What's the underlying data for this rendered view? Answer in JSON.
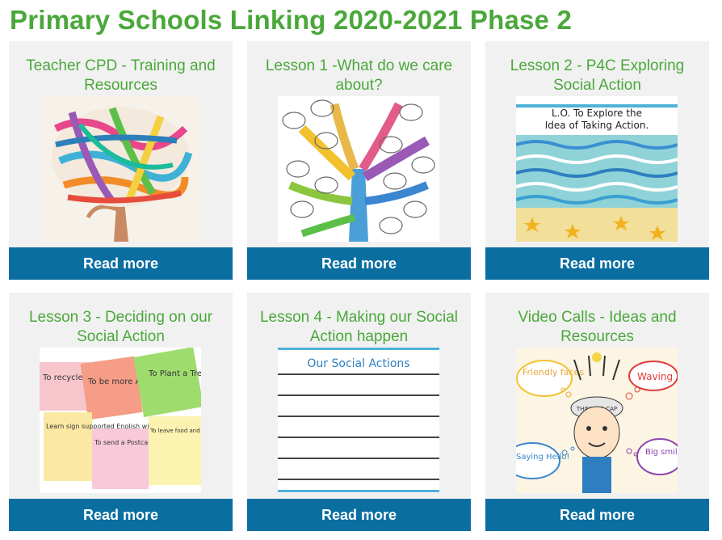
{
  "page": {
    "title": "Primary Schools Linking 2020-2021 Phase 2"
  },
  "cards": [
    {
      "title": "Teacher CPD - Training and Resources",
      "button": "Read more",
      "image": "colourful-ribbon-tree"
    },
    {
      "title": "Lesson 1 -What do we care about?",
      "button": "Read more",
      "image": "rainbow-tree-with-speech-bubbles"
    },
    {
      "title": "Lesson 2 - P4C Exploring Social Action",
      "button": "Read more",
      "image": "sea-and-beach-painting",
      "image_text": [
        "L.O. To Explore the",
        "Idea of Taking Action."
      ]
    },
    {
      "title": "Lesson 3 - Deciding on our Social Action",
      "button": "Read more",
      "image": "sticky-notes",
      "image_text": [
        "To recycle all we can...",
        "To be more Active...",
        "To Plant a Tree",
        "Learn sign supported English with our Linking Partners.",
        "To send a Postcard to our local Care Home",
        "To leave food and water for the birds near our school."
      ]
    },
    {
      "title": "Lesson 4 - Making our Social Action happen",
      "button": "Read more",
      "image": "lined-worksheet",
      "image_text": [
        "Our Social Actions"
      ]
    },
    {
      "title": "Video Calls - Ideas and Resources",
      "button": "Read more",
      "image": "thinking-cap-child",
      "image_text": [
        "Friendly faces",
        "Waving",
        "Saying Hello!",
        "Big smiles",
        "THINKING CAP"
      ]
    }
  ],
  "colors": {
    "title_green": "#4aa83a",
    "button_blue": "#0a6ea1",
    "card_bg": "#f1f1f1"
  }
}
